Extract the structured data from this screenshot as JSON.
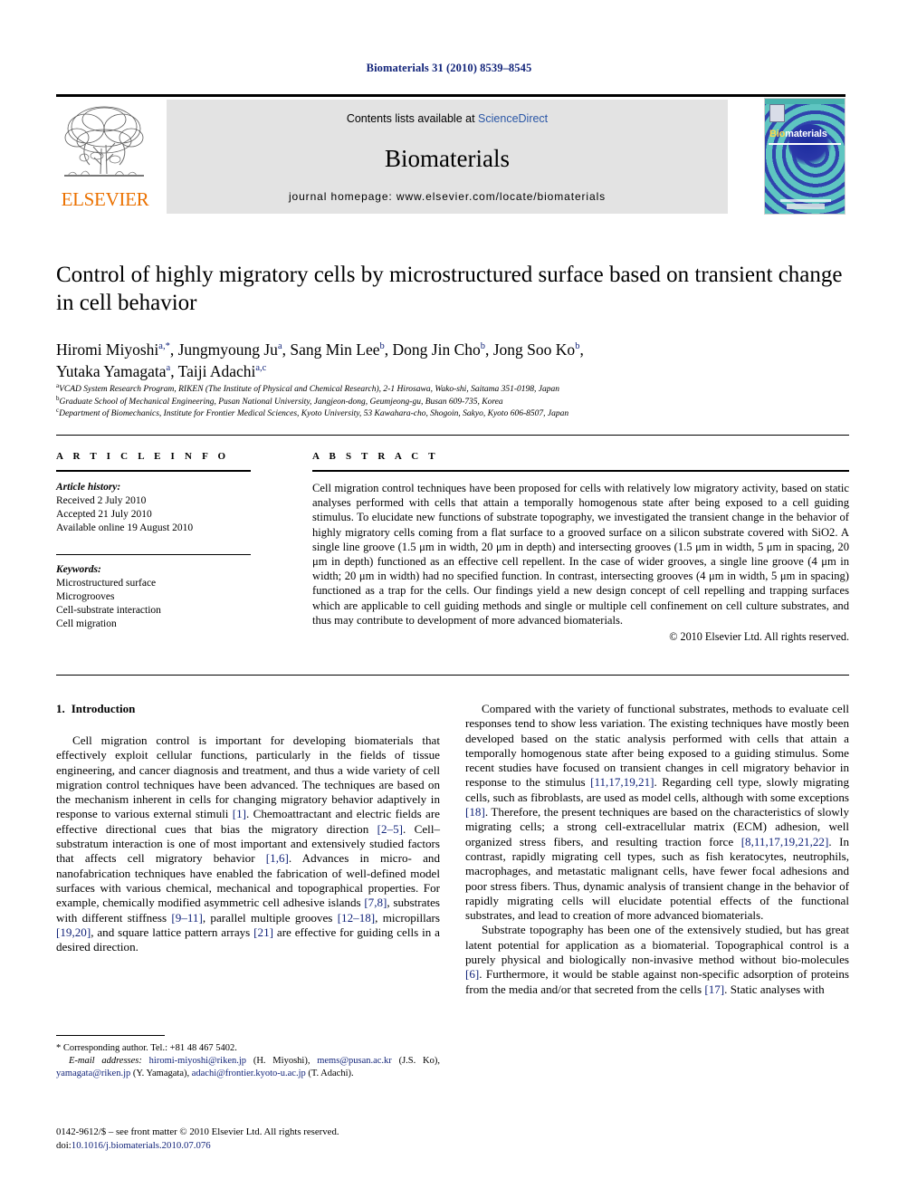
{
  "running_head": "Biomaterials 31 (2010) 8539–8545",
  "masthead": {
    "publisher_name": "ELSEVIER",
    "contents_prefix": "Contents lists available at",
    "contents_link": "ScienceDirect",
    "journal_name": "Biomaterials",
    "homepage_line": "journal homepage: www.elsevier.com/locate/biomaterials",
    "cover_title_part1": "Bio",
    "cover_title_part2": "materials",
    "accent_orange": "#eb7100",
    "link_blue": "#2b57a6",
    "cover_teal": "#49b3ae",
    "cover_blue": "#2f3fae"
  },
  "article": {
    "title": "Control of highly migratory cells by microstructured surface based on transient change in cell behavior",
    "authors_line1_parts": [
      {
        "name": "Hiromi Miyoshi",
        "sup": "a,*"
      },
      {
        "name": ", Jungmyoung Ju",
        "sup": "a"
      },
      {
        "name": ", Sang Min Lee",
        "sup": "b"
      },
      {
        "name": ", Dong Jin Cho",
        "sup": "b"
      },
      {
        "name": ", Jong Soo Ko",
        "sup": "b"
      },
      {
        "name": ",",
        "sup": ""
      }
    ],
    "authors_line2_parts": [
      {
        "name": "Yutaka Yamagata",
        "sup": "a"
      },
      {
        "name": ", Taiji Adachi",
        "sup": "a,c"
      }
    ],
    "affiliations": [
      {
        "mark": "a",
        "text": "VCAD System Research Program, RIKEN (The Institute of Physical and Chemical Research), 2-1 Hirosawa, Wako-shi, Saitama 351-0198, Japan"
      },
      {
        "mark": "b",
        "text": "Graduate School of Mechanical Engineering, Pusan National University, Jangjeon-dong, Geumjeong-gu, Busan 609-735, Korea"
      },
      {
        "mark": "c",
        "text": "Department of Biomechanics, Institute for Frontier Medical Sciences, Kyoto University, 53 Kawahara-cho, Shogoin, Sakyo, Kyoto 606-8507, Japan"
      }
    ]
  },
  "article_info": {
    "heading": "A R T I C L E  I N F O",
    "history_label": "Article history:",
    "history": [
      "Received 2 July 2010",
      "Accepted 21 July 2010",
      "Available online 19 August 2010"
    ],
    "keywords_label": "Keywords:",
    "keywords": [
      "Microstructured surface",
      "Microgrooves",
      "Cell-substrate interaction",
      "Cell migration"
    ]
  },
  "abstract": {
    "heading": "A B S T R A C T",
    "text": "Cell migration control techniques have been proposed for cells with relatively low migratory activity, based on static analyses performed with cells that attain a temporally homogenous state after being exposed to a cell guiding stimulus. To elucidate new functions of substrate topography, we investigated the transient change in the behavior of highly migratory cells coming from a flat surface to a grooved surface on a silicon substrate covered with SiO2. A single line groove (1.5 μm in width, 20 μm in depth) and intersecting grooves (1.5 μm in width, 5 μm in spacing, 20 μm in depth) functioned as an effective cell repellent. In the case of wider grooves, a single line groove (4 μm in width; 20 μm in width) had no specified function. In contrast, intersecting grooves (4 μm in width, 5 μm in spacing) functioned as a trap for the cells. Our findings yield a new design concept of cell repelling and trapping surfaces which are applicable to cell guiding methods and single or multiple cell confinement on cell culture substrates, and thus may contribute to development of more advanced biomaterials.",
    "copyright": "© 2010 Elsevier Ltd. All rights reserved."
  },
  "introduction": {
    "section_number": "1.",
    "section_title": "Introduction",
    "paragraph1_a": "Cell migration control is important for developing biomaterials that effectively exploit cellular functions, particularly in the fields of tissue engineering, and cancer diagnosis and treatment, and thus a wide variety of cell migration control techniques have been advanced. The techniques are based on the mechanism inherent in cells for changing migratory behavior adaptively in response to various external stimuli ",
    "ref1": "[1]",
    "paragraph1_b": ". Chemoattractant and electric fields are effective directional cues that bias the migratory direction ",
    "ref2": "[2–5]",
    "paragraph1_c": ". Cell–substratum interaction is one of most important and extensively studied factors that affects cell migratory behavior ",
    "ref3": "[1,6]",
    "paragraph1_d": ". Advances in micro- and nanofabrication techniques have enabled the fabrication of well-defined model surfaces with various chemical, mechanical and topographical properties. For example, chemically modified asymmetric cell adhesive islands ",
    "ref4": "[7,8]",
    "paragraph1_e": ", substrates with different stiffness ",
    "ref5": "[9–11]",
    "paragraph1_f": ", parallel multiple grooves ",
    "ref6": "[12–18]",
    "paragraph1_g": ", micropillars ",
    "ref7": "[19,20]",
    "paragraph1_h": ", and square lattice pattern arrays ",
    "ref8": "[21]",
    "paragraph1_i": " are effective for guiding cells in a desired direction.",
    "paragraph2_a": "Compared with the variety of functional substrates, methods to evaluate cell responses tend to show less variation. The existing techniques have mostly been developed based on the static analysis performed with cells that attain a temporally homogenous state after being exposed to a guiding stimulus. Some recent studies have focused on transient changes in cell migratory behavior in response to the stimulus ",
    "ref9": "[11,17,19,21]",
    "paragraph2_b": ". Regarding cell type, slowly migrating cells, such as fibroblasts, are used as model cells, although with some exceptions ",
    "ref10": "[18]",
    "paragraph2_c": ". Therefore, the present techniques are based on the characteristics of slowly migrating cells; a strong cell-extracellular matrix (ECM) adhesion, well organized stress fibers, and resulting traction force ",
    "ref11": "[8,11,17,19,21,22]",
    "paragraph2_d": ". In contrast, rapidly migrating cell types, such as fish keratocytes, neutrophils, macrophages, and metastatic malignant cells, have fewer focal adhesions and poor stress fibers. Thus, dynamic analysis of transient change in the behavior of rapidly migrating cells will elucidate potential effects of the functional substrates, and lead to creation of more advanced biomaterials.",
    "paragraph3_a": "Substrate topography has been one of the extensively studied, but has great latent potential for application as a biomaterial. Topographical control is a purely physical and biologically non-invasive method without bio-molecules ",
    "ref12": "[6]",
    "paragraph3_b": ". Furthermore, it would be stable against non-specific adsorption of proteins from the media and/or that secreted from the cells ",
    "ref13": "[17]",
    "paragraph3_c": ". Static analyses with"
  },
  "footnote": {
    "corresponding": "* Corresponding author. Tel.: +81 48 467 5402.",
    "email_label": "E-mail addresses:",
    "emails": [
      {
        "address": "hiromi-miyoshi@riken.jp",
        "owner": "(H. Miyoshi)"
      },
      {
        "address": "mems@pusan.ac.kr",
        "owner": "(J.S. Ko)"
      },
      {
        "address": "yamagata@riken.jp",
        "owner": "(Y. Yamagata)"
      },
      {
        "address": "adachi@frontier.kyoto-u.ac.jp",
        "owner": "(T. Adachi)"
      }
    ]
  },
  "page_footer": {
    "issn_line": "0142-9612/$ – see front matter © 2010 Elsevier Ltd. All rights reserved.",
    "doi_label": "doi:",
    "doi_value": "10.1016/j.biomaterials.2010.07.076"
  }
}
